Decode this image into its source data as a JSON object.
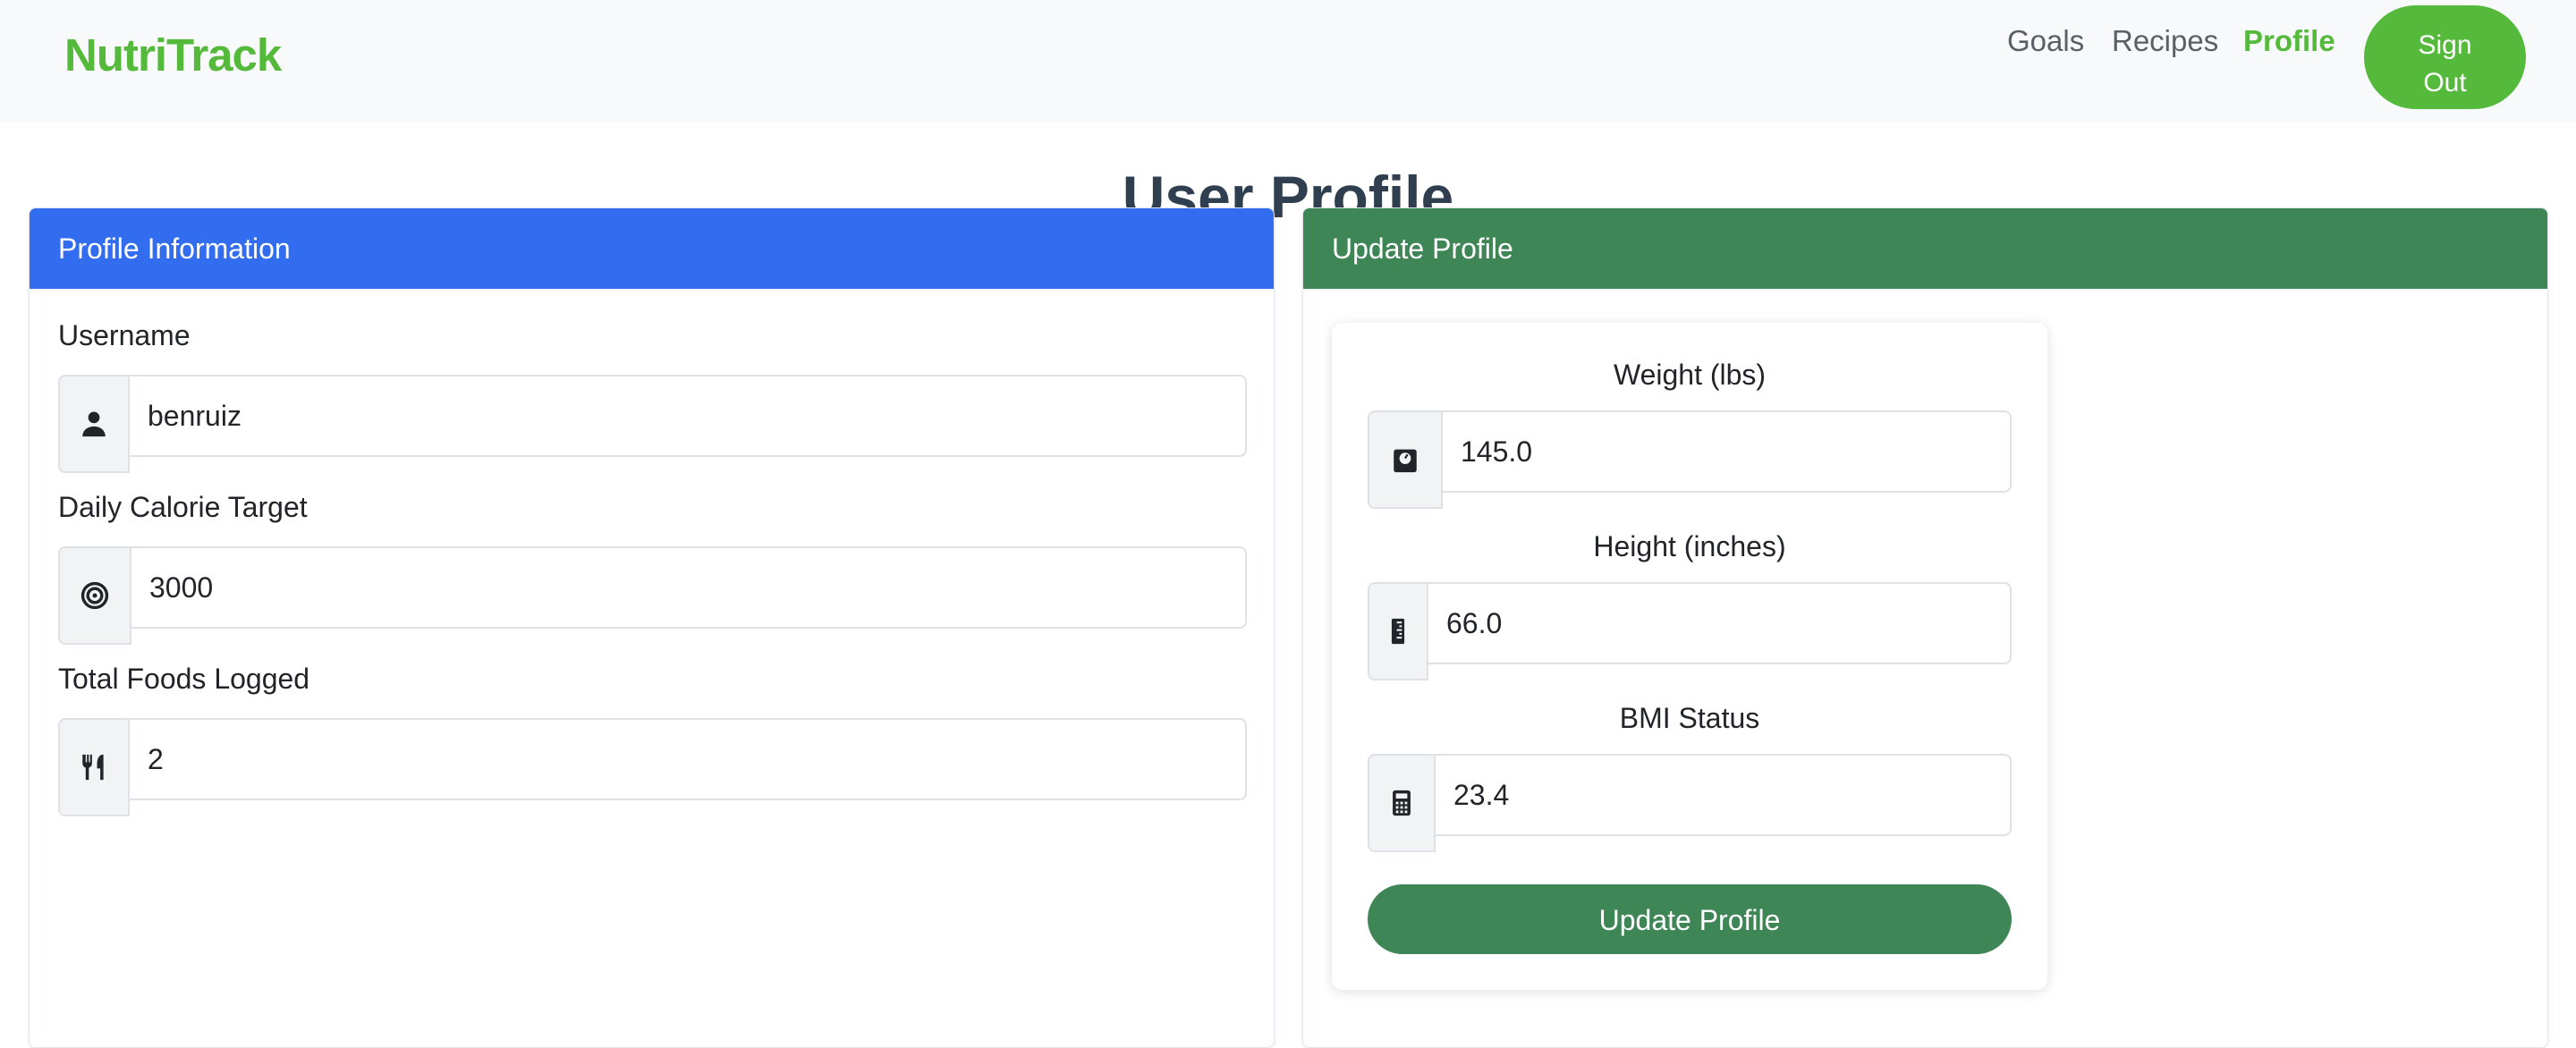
{
  "navbar": {
    "brand": "NutriTrack",
    "links": [
      {
        "label": "Goals"
      },
      {
        "label": "Recipes"
      },
      {
        "label": "Profile"
      }
    ],
    "signout_line1": "Sign",
    "signout_line2": "Out"
  },
  "page": {
    "title": "User Profile"
  },
  "profile_info": {
    "header": "Profile Information",
    "username_label": "Username",
    "username_value": "benruiz",
    "calorie_label": "Daily Calorie Target",
    "calorie_value": "3000",
    "foods_label": "Total Foods Logged",
    "foods_value": "2"
  },
  "update_profile": {
    "header": "Update Profile",
    "weight_label": "Weight (lbs)",
    "weight_value": "145.0",
    "height_label": "Height (inches)",
    "height_value": "66.0",
    "bmi_label": "BMI Status",
    "bmi_value": "23.4",
    "button_label": "Update Profile"
  },
  "icons": {
    "username": "user-icon",
    "calorie": "bullseye-icon",
    "foods": "utensils-icon",
    "weight": "weight-scale-icon",
    "height": "ruler-icon",
    "bmi": "calculator-icon"
  },
  "colors": {
    "brand": "#55b93b",
    "profile_header": "#326df0",
    "update_header": "#3f8657",
    "title": "#2f3f4f"
  }
}
